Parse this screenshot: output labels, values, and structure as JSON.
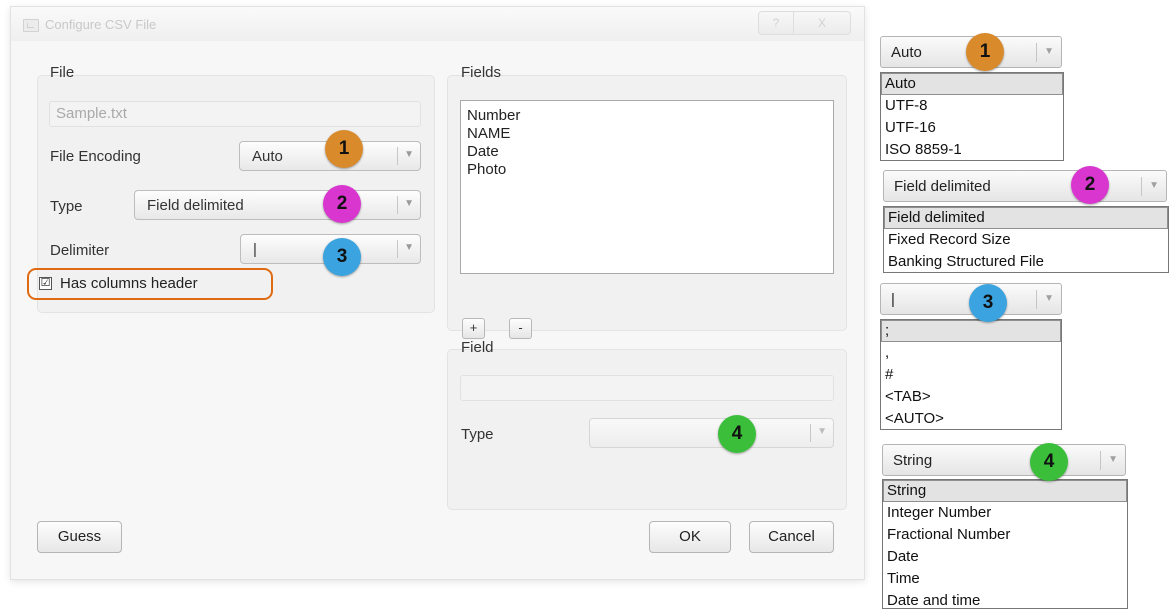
{
  "window": {
    "title": "Configure CSV File",
    "help_label": "?",
    "close_label": "X"
  },
  "file_group": {
    "title": "File",
    "filename_value": "Sample.txt",
    "encoding_label": "File Encoding",
    "encoding_value": "Auto",
    "type_label": "Type",
    "type_value": "Field delimited",
    "delimiter_label": "Delimiter",
    "delimiter_value": "|",
    "has_header_label": "Has columns header",
    "has_header_checked": true,
    "checkmark": "☑"
  },
  "fields_group": {
    "title": "Fields",
    "items": [
      "Number",
      "NAME",
      "Date",
      "Photo"
    ],
    "add_label": "+",
    "remove_label": "-"
  },
  "field_group": {
    "title": "Field",
    "name_value": "",
    "type_label": "Type",
    "type_value": ""
  },
  "buttons": {
    "guess": "Guess",
    "ok": "OK",
    "cancel": "Cancel"
  },
  "callouts": {
    "one": "1",
    "two": "2",
    "three": "3",
    "four": "4"
  },
  "callout_colors": {
    "one": "#d98a2b",
    "two": "#d936d0",
    "three": "#3ba3df",
    "four": "#3bbf3b",
    "highlight": "#de6b12"
  },
  "dropdown_legends": {
    "encoding": {
      "current": "Auto",
      "options": [
        "Auto",
        "UTF-8",
        "UTF-16",
        "ISO 8859-1"
      ],
      "selected": "Auto"
    },
    "type": {
      "current": "Field delimited",
      "options": [
        "Field delimited",
        "Fixed Record Size",
        "Banking Structured File"
      ],
      "selected": "Field delimited"
    },
    "delimiter": {
      "current": "|",
      "options": [
        ";",
        ",",
        "#",
        "<TAB>",
        "<AUTO>"
      ],
      "selected": ";"
    },
    "field_type": {
      "current": "String",
      "options": [
        "String",
        "Integer Number",
        "Fractional Number",
        "Date",
        "Time",
        "Date and time"
      ],
      "selected": "String"
    }
  },
  "icons": {
    "dropdown_arrow": "▼"
  }
}
